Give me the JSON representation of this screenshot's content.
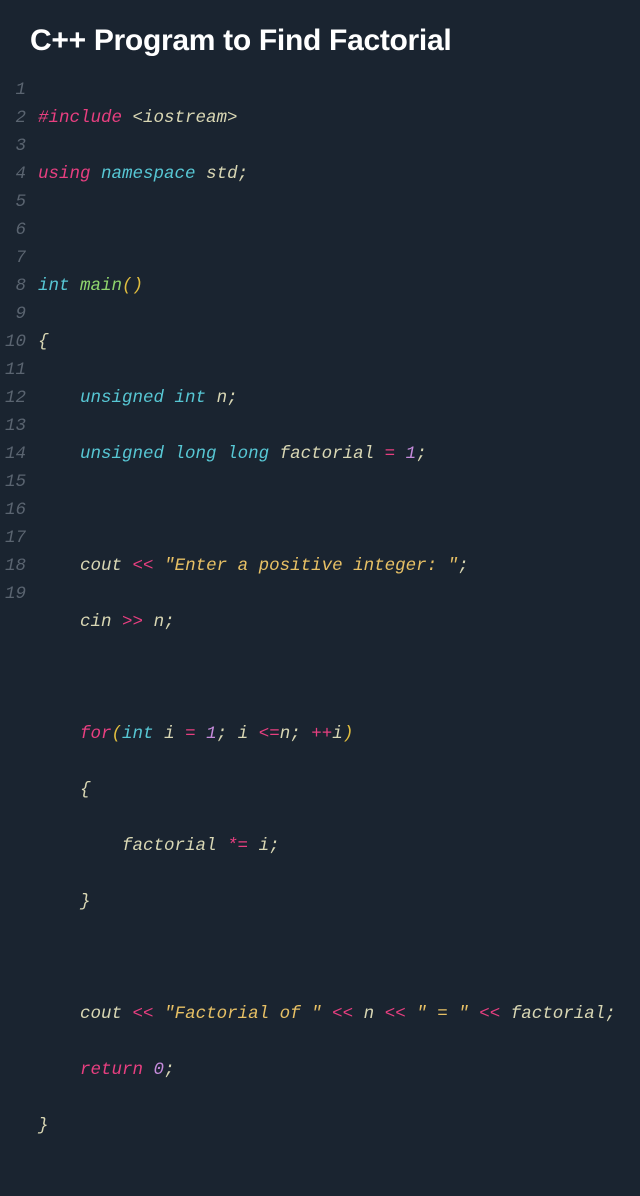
{
  "title": "C++ Program to Find Factorial",
  "line_numbers": [
    "1",
    "2",
    "3",
    "4",
    "5",
    "6",
    "7",
    "8",
    "9",
    "10",
    "11",
    "12",
    "13",
    "14",
    "15",
    "16",
    "17",
    "18",
    "19"
  ],
  "code": {
    "l1": {
      "a": "#include",
      "b": "<iostream>"
    },
    "l2": {
      "a": "using",
      "b": "namespace",
      "c": "std",
      "d": ";"
    },
    "l4": {
      "a": "int",
      "b": "main",
      "c": "()"
    },
    "l5": {
      "a": "{"
    },
    "l6": {
      "a": "unsigned",
      "b": "int",
      "c": "n",
      "d": ";"
    },
    "l7": {
      "a": "unsigned",
      "b": "long",
      "c": "long",
      "d": "factorial",
      "e": "=",
      "f": "1",
      "g": ";"
    },
    "l9": {
      "a": "cout",
      "b": "<<",
      "c": "\"Enter a positive integer: \"",
      "d": ";"
    },
    "l10": {
      "a": "cin",
      "b": ">>",
      "c": "n",
      "d": ";"
    },
    "l12": {
      "a": "for",
      "b": "(",
      "c": "int",
      "d": "i",
      "e": "=",
      "f": "1",
      "g": ";",
      "h": "i",
      "i": "<=",
      "j": "n",
      "k": ";",
      "l": "++",
      "m": "i",
      "n": ")"
    },
    "l13": {
      "a": "{"
    },
    "l14": {
      "a": "factorial",
      "b": "*=",
      "c": "i",
      "d": ";"
    },
    "l15": {
      "a": "}"
    },
    "l17": {
      "a": "cout",
      "b": "<<",
      "c": "\"Factorial of \"",
      "d": "<<",
      "e": "n",
      "f": "<<",
      "g": "\" = \"",
      "h": "<<",
      "i": "factorial",
      "j": ";"
    },
    "l18": {
      "a": "return",
      "b": "0",
      "c": ";"
    },
    "l19": {
      "a": "}"
    }
  }
}
